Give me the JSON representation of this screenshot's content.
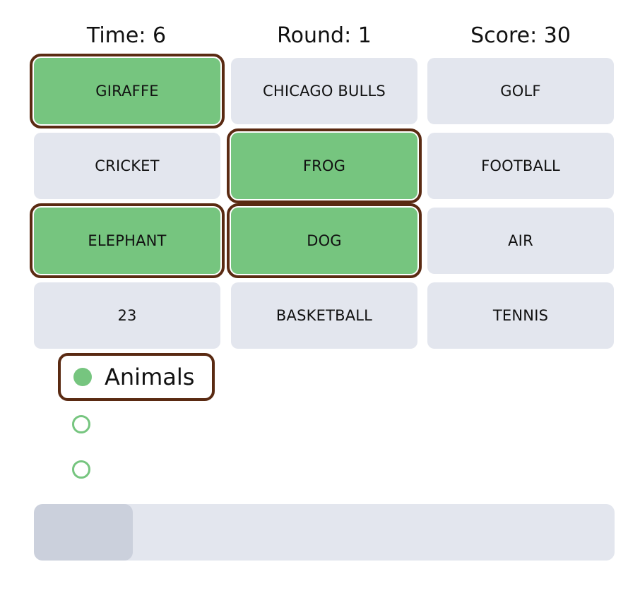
{
  "stats": {
    "time": "Time: 6",
    "round": "Round: 1",
    "score": "Score: 30"
  },
  "tiles": [
    {
      "label": "GIRAFFE",
      "selected": true
    },
    {
      "label": "CHICAGO BULLS",
      "selected": false
    },
    {
      "label": "GOLF",
      "selected": false
    },
    {
      "label": "CRICKET",
      "selected": false
    },
    {
      "label": "FROG",
      "selected": true
    },
    {
      "label": "FOOTBALL",
      "selected": false
    },
    {
      "label": "ELEPHANT",
      "selected": true
    },
    {
      "label": "DOG",
      "selected": true
    },
    {
      "label": "AIR",
      "selected": false
    },
    {
      "label": "23",
      "selected": false
    },
    {
      "label": "BASKETBALL",
      "selected": false
    },
    {
      "label": "TENNIS",
      "selected": false
    }
  ],
  "categories": [
    {
      "label": "Animals",
      "found": true
    },
    {
      "label": "",
      "found": false
    },
    {
      "label": "",
      "found": false
    }
  ],
  "progress": {
    "fraction": 0.17
  },
  "colors": {
    "selected_tile": "#76c57f",
    "tile": "#e3e6ee",
    "outline": "#5a2a12",
    "progress_fill": "#cbd0dc"
  }
}
